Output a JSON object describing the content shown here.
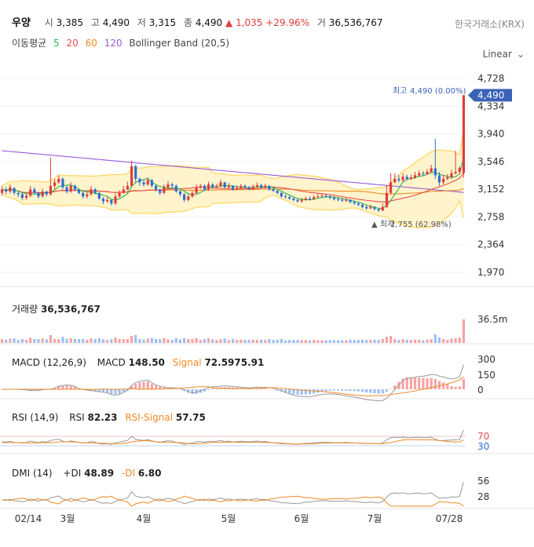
{
  "header": {
    "name": "우양",
    "open_label": "시",
    "open": "3,385",
    "high_label": "고",
    "high": "4,490",
    "low_label": "저",
    "low": "3,315",
    "close_label": "종",
    "close": "4,490",
    "change_arrow": "▲",
    "change": "1,035",
    "change_pct": "+29.96%",
    "volume_label": "거",
    "volume": "36,536,767",
    "exchange": "한국거래소(KRX)"
  },
  "ma_legend": {
    "label": "이동평균",
    "periods": [
      "5",
      "20",
      "60",
      "120"
    ],
    "bollinger": "Bollinger Band (20,5)"
  },
  "scale_selector": {
    "value": "Linear"
  },
  "colors": {
    "ma5": "#2bb34a",
    "ma20": "#e84c4c",
    "ma60": "#f08a24",
    "ma120": "#9b59d8",
    "up": "#e03c3c",
    "down": "#2e6fd1",
    "band": "#ffd866",
    "band_fill": "#fff4cc",
    "current_tag": "#3a62b6"
  },
  "price_axis": {
    "ticks": [
      "4,728",
      "4,334",
      "3,940",
      "3,546",
      "3,152",
      "2,758",
      "2,364",
      "1,970"
    ],
    "current": "4,490"
  },
  "annotations": {
    "high_label": "최고",
    "high_value": "4,490 (0.00%)",
    "low_label": "최저",
    "low_value": "2,755 (62.98%)"
  },
  "volume_panel": {
    "label": "거래량",
    "value": "36,536,767",
    "axis": "36.5m"
  },
  "macd_panel": {
    "label": "MACD (12,26,9)",
    "macd_label": "MACD",
    "macd_value": "148.50",
    "signal_label": "Signal",
    "signal_value": "72.5975.91",
    "axis": [
      "300",
      "150",
      "0"
    ]
  },
  "rsi_panel": {
    "label": "RSI (14,9)",
    "rsi_label": "RSI",
    "rsi_value": "82.23",
    "signal_label": "RSI-Signal",
    "signal_value": "57.75",
    "axis": [
      "70",
      "30"
    ]
  },
  "dmi_panel": {
    "label": "DMI (14)",
    "pdi_label": "+DI",
    "pdi_value": "48.89",
    "mdi_label": "-DI",
    "mdi_value": "6.80",
    "axis": [
      "56",
      "28"
    ]
  },
  "x_axis": {
    "ticks": [
      "02/14",
      "3월",
      "4월",
      "5월",
      "6월",
      "7월",
      "07/28"
    ]
  },
  "chart_data": {
    "type": "candlestick",
    "ylim": [
      1970,
      4728
    ],
    "close": [
      3150,
      3120,
      3180,
      3100,
      3080,
      3030,
      3060,
      3150,
      3100,
      3050,
      3120,
      3080,
      3200,
      3250,
      3300,
      3180,
      3120,
      3200,
      3150,
      3100,
      3050,
      3080,
      3150,
      3100,
      3020,
      2980,
      3000,
      2950,
      3050,
      3100,
      3150,
      3200,
      3480,
      3300,
      3250,
      3220,
      3280,
      3200,
      3150,
      3100,
      3180,
      3220,
      3200,
      3120,
      3080,
      3000,
      3050,
      3100,
      3180,
      3200,
      3150,
      3220,
      3180,
      3200,
      3250,
      3180,
      3200,
      3150,
      3170,
      3200,
      3180,
      3160,
      3190,
      3210,
      3180,
      3200,
      3150,
      3130,
      3100,
      3050,
      3040,
      3020,
      3000,
      2980,
      3000,
      3020,
      3010,
      3040,
      3050,
      3060,
      3050,
      3030,
      3010,
      3000,
      2990,
      3000,
      2970,
      2950,
      2930,
      2900,
      2880,
      2900,
      2870,
      2850,
      2900,
      3100,
      3250,
      3300,
      3280,
      3330,
      3300,
      3320,
      3350,
      3380,
      3370,
      3400,
      3450,
      3350,
      3250,
      3300,
      3320,
      3380,
      3400,
      3455,
      4490
    ],
    "open": [
      3100,
      3150,
      3120,
      3170,
      3100,
      3080,
      3030,
      3060,
      3150,
      3100,
      3050,
      3120,
      3080,
      3200,
      3250,
      3300,
      3180,
      3120,
      3200,
      3150,
      3100,
      3050,
      3080,
      3150,
      3100,
      3020,
      2980,
      3000,
      2950,
      3050,
      3100,
      3150,
      3200,
      3480,
      3300,
      3250,
      3220,
      3280,
      3200,
      3150,
      3100,
      3180,
      3220,
      3200,
      3120,
      3080,
      3000,
      3050,
      3100,
      3180,
      3200,
      3150,
      3220,
      3180,
      3200,
      3250,
      3180,
      3200,
      3150,
      3170,
      3200,
      3180,
      3160,
      3190,
      3210,
      3180,
      3200,
      3150,
      3130,
      3100,
      3050,
      3040,
      3020,
      3000,
      2980,
      3000,
      3020,
      3010,
      3040,
      3050,
      3060,
      3050,
      3030,
      3010,
      3000,
      2990,
      3000,
      2970,
      2950,
      2930,
      2900,
      2880,
      2900,
      2870,
      2850,
      2900,
      3100,
      3250,
      3300,
      3280,
      3330,
      3300,
      3320,
      3350,
      3380,
      3370,
      3400,
      3450,
      3350,
      3250,
      3300,
      3320,
      3380,
      3400,
      3385
    ],
    "high": [
      3200,
      3180,
      3220,
      3180,
      3120,
      3100,
      3080,
      3200,
      3180,
      3120,
      3160,
      3130,
      3600,
      3300,
      3350,
      3320,
      3200,
      3250,
      3220,
      3160,
      3120,
      3110,
      3200,
      3170,
      3110,
      3040,
      3040,
      3010,
      3090,
      3140,
      3200,
      3260,
      3560,
      3500,
      3320,
      3280,
      3320,
      3300,
      3220,
      3160,
      3220,
      3270,
      3250,
      3220,
      3140,
      3100,
      3080,
      3130,
      3220,
      3230,
      3220,
      3260,
      3240,
      3230,
      3290,
      3260,
      3240,
      3210,
      3210,
      3230,
      3220,
      3200,
      3220,
      3250,
      3230,
      3230,
      3210,
      3170,
      3140,
      3110,
      3080,
      3060,
      3040,
      3020,
      3030,
      3050,
      3050,
      3070,
      3090,
      3090,
      3090,
      3070,
      3050,
      3030,
      3030,
      3030,
      3010,
      2990,
      2970,
      2950,
      2920,
      2930,
      2910,
      2880,
      2950,
      3200,
      3380,
      3380,
      3350,
      3380,
      3360,
      3360,
      3400,
      3420,
      3410,
      3440,
      3500,
      3870,
      3400,
      3350,
      3370,
      3430,
      3700,
      3480,
      4490
    ],
    "low": [
      3060,
      3080,
      3090,
      3070,
      3040,
      3000,
      3000,
      3040,
      3080,
      3020,
      3030,
      3050,
      3060,
      3150,
      3230,
      3150,
      3090,
      3100,
      3120,
      3080,
      3020,
      3020,
      3060,
      3080,
      3000,
      2940,
      2960,
      2920,
      2930,
      3030,
      3090,
      3140,
      3180,
      3250,
      3200,
      3190,
      3200,
      3180,
      3120,
      3070,
      3080,
      3150,
      3170,
      3100,
      3050,
      2970,
      2980,
      3030,
      3080,
      3150,
      3130,
      3130,
      3160,
      3160,
      3180,
      3160,
      3160,
      3130,
      3140,
      3150,
      3160,
      3140,
      3140,
      3170,
      3160,
      3160,
      3130,
      3110,
      3080,
      3030,
      3020,
      3000,
      2980,
      2960,
      2960,
      2990,
      2990,
      3000,
      3030,
      3040,
      3030,
      3010,
      2990,
      2980,
      2970,
      2970,
      2950,
      2930,
      2910,
      2880,
      2860,
      2870,
      2850,
      2830,
      2840,
      2880,
      3080,
      3240,
      3250,
      3260,
      3280,
      3280,
      3300,
      3330,
      3340,
      3360,
      3380,
      3300,
      3200,
      3220,
      3280,
      3300,
      3360,
      3370,
      3315
    ]
  }
}
